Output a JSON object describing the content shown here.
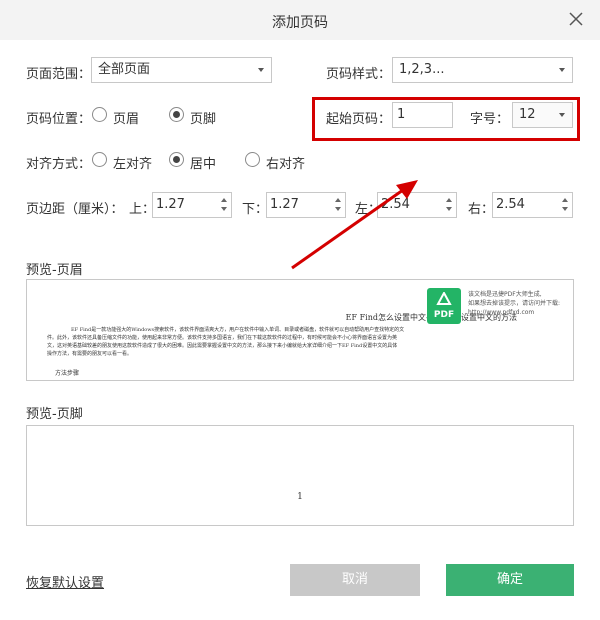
{
  "dialog": {
    "title": "添加页码"
  },
  "page_range": {
    "label": "页面范围：",
    "value": "全部页面"
  },
  "page_style": {
    "label": "页码样式：",
    "value": "1,2,3..."
  },
  "position": {
    "label": "页码位置：",
    "header": "页眉",
    "footer": "页脚",
    "selected": "footer"
  },
  "start_number": {
    "label": "起始页码：",
    "value": "1"
  },
  "font_size": {
    "label": "字号：",
    "value": "12"
  },
  "alignment": {
    "label": "对齐方式：",
    "left": "左对齐",
    "center": "居中",
    "right": "右对齐",
    "selected": "center"
  },
  "margins": {
    "label": "页边距（厘米）：",
    "top_label": "上：",
    "top": "1.27",
    "bottom_label": "下：",
    "bottom": "1.27",
    "left_label": "左：",
    "left": "2.54",
    "right_label": "右：",
    "right": "2.54"
  },
  "preview_header": {
    "label": "预览-页眉",
    "doc_title": "EF Find怎么设置中文-EF Find设置中文的方法",
    "body_lines": [
      "EF Find是一款功能强大的Windows搜索软件，该软件界面清爽大方，用户在软件中输入单词、目录或者磁盘，软件就可以自动帮助用户查找特定的文",
      "件。此外，该软件还具备压缩文件的功能，使用起来非常方便。该软件支持多国语言，我们在下载这款软件的过程中，有时候可能会不小心将界面语言设置为英",
      "文，这对英语基础较差的朋友使用这款软件造成了很大的困难。因此需要掌握设置中文的方法，那么接下来小编就给大家详细介绍一下EF Find设置中文的具体",
      "操作方法，有需要的朋友可以看一看。"
    ],
    "section": "方法步骤"
  },
  "watermark": {
    "logo_text": "PDF",
    "line1": "该文档是迅捷PDF大师生成,",
    "line2": "如果想去掉该提示，请访问并下载:",
    "line3": "http://www.pdfxd.com"
  },
  "preview_footer": {
    "label": "预览-页脚",
    "page_number": "1"
  },
  "buttons": {
    "reset": "恢复默认设置",
    "cancel": "取消",
    "ok": "确定"
  },
  "colors": {
    "annotation_red": "#d40000",
    "ok_green": "#3bb173",
    "cancel_gray": "#c8c8c8",
    "logo_green": "#23b466"
  }
}
